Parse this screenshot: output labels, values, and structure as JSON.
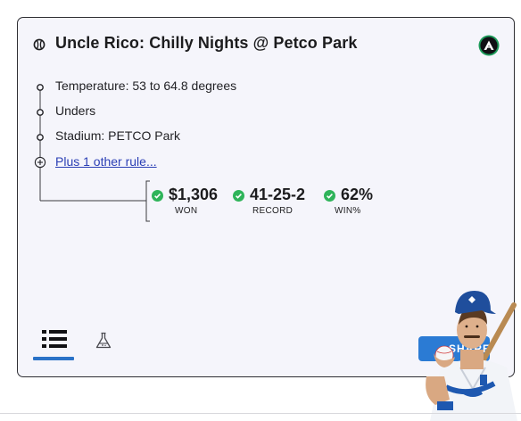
{
  "card": {
    "title": "Uncle Rico: Chilly Nights @ Petco Park",
    "rules": [
      "Temperature: 53 to 64.8 degrees",
      "Unders",
      "Stadium: PETCO Park"
    ],
    "more_rules_link": "Plus 1 other rule...",
    "stats": [
      {
        "value": "$1,306",
        "label": "WON"
      },
      {
        "value": "41-25-2",
        "label": "RECORD"
      },
      {
        "value": "62%",
        "label": "WIN%"
      }
    ]
  },
  "tabs": [
    {
      "icon": "list-icon",
      "active": true
    },
    {
      "icon": "flask-icon",
      "active": false
    }
  ],
  "share_button": {
    "label": "SHARE"
  },
  "colors": {
    "card_background": "#f5f5fb",
    "check_green": "#2fb45a",
    "link_blue": "#2b3fb5",
    "accent_blue": "#2a72c7",
    "button_blue": "#2b7bd4",
    "logo_green": "#1d9b5a"
  }
}
